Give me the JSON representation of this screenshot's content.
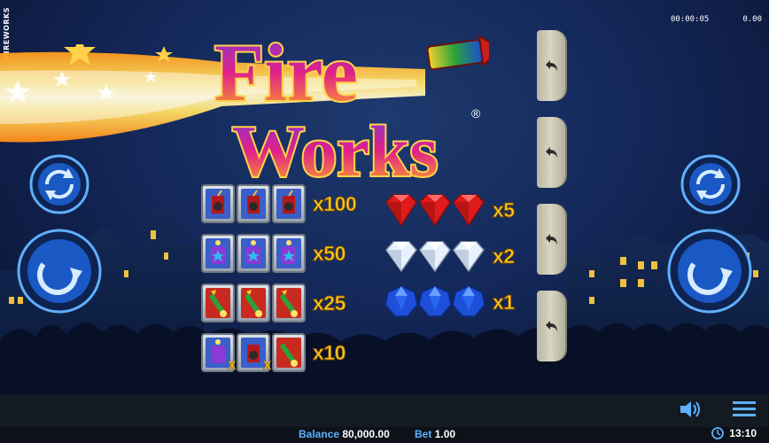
{
  "game": {
    "side_label": "FIREWORKS",
    "logo_line1": "Fire",
    "logo_line2": "Works",
    "trademark": "®"
  },
  "status": {
    "timer": "00:00:05",
    "win": "0.00"
  },
  "paytable": {
    "rockets": [
      {
        "symbol": "firecracker",
        "multiplier": "x100"
      },
      {
        "symbol": "purple-firework",
        "multiplier": "x50"
      },
      {
        "symbol": "green-rocket",
        "multiplier": "x25"
      },
      {
        "symbol": "mixed-any",
        "multiplier": "x10"
      }
    ],
    "gems": [
      {
        "symbol": "ruby",
        "multiplier": "x5",
        "color": "#e01b1b"
      },
      {
        "symbol": "diamond",
        "multiplier": "x2",
        "color": "#e8f2ff"
      },
      {
        "symbol": "sapphire",
        "multiplier": "x1",
        "color": "#1d4fd8"
      }
    ],
    "x_mark": "X"
  },
  "controls": {
    "undo_icons": [
      "undo-icon",
      "undo-icon",
      "undo-icon",
      "undo-icon"
    ],
    "left_small": "autoplay-icon",
    "left_big": "play-icon",
    "right_small": "autoplay-icon",
    "right_big": "play-icon"
  },
  "footer": {
    "balance_label": "Balance",
    "balance_value": "80,000.00",
    "bet_label": "Bet",
    "bet_value": "1.00",
    "time": "13:10"
  },
  "colors": {
    "accent": "#5fb0ff",
    "multiplier": "#ffcf1f",
    "button_blue": "#1a58c4"
  }
}
